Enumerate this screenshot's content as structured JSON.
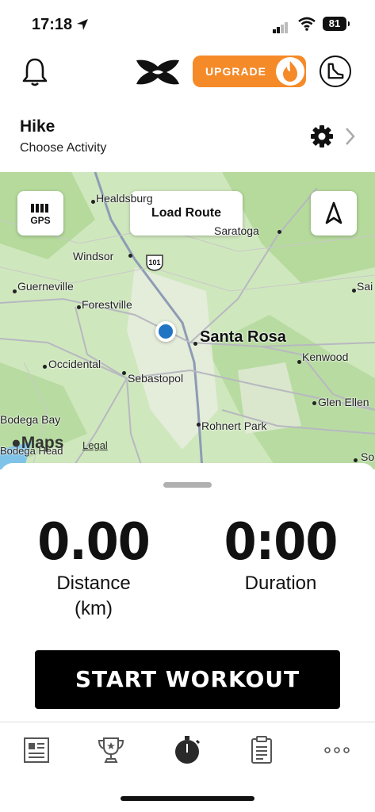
{
  "status_bar": {
    "time": "17:18",
    "battery": "81"
  },
  "header": {
    "upgrade_label": "UPGRADE"
  },
  "activity": {
    "title": "Hike",
    "subtitle": "Choose Activity"
  },
  "map": {
    "gps_label": "GPS",
    "load_route_label": "Load Route",
    "places": [
      "Healdsburg",
      "Saratoga",
      "Windsor",
      "Guerneville",
      "Forestville",
      "Santa Rosa",
      "Occidental",
      "Sebastopol",
      "Kenwood",
      "Glen Ellen",
      "Rohnert Park",
      "Bodega Bay",
      "Bodega Head",
      "Sai",
      "So"
    ],
    "highway": "101",
    "attribution": "Maps",
    "legal": "Legal"
  },
  "stats": {
    "distance": {
      "value": "0.00",
      "label": "Distance",
      "unit": "(km)"
    },
    "duration": {
      "value": "0:00",
      "label": "Duration"
    }
  },
  "start_button": "START WORKOUT",
  "tabs": [
    "feed-icon",
    "trophy-icon",
    "stopwatch-icon",
    "clipboard-icon",
    "more-icon"
  ],
  "colors": {
    "accent": "#f58a29",
    "location": "#1f74c4",
    "map_bg": "#cfe7bd"
  }
}
